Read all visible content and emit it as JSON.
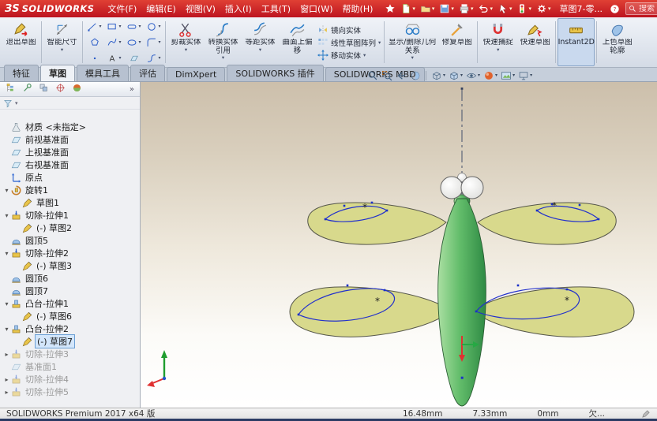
{
  "titlebar": {
    "logo_mark": "ЗS",
    "logo_text": "SOLIDWORKS",
    "menus": [
      "文件(F)",
      "编辑(E)",
      "视图(V)",
      "插入(I)",
      "工具(T)",
      "窗口(W)",
      "帮助(H)"
    ],
    "tools": [
      {
        "name": "pin-toolbar-button",
        "icon": "star",
        "caret": false
      },
      {
        "name": "new-document-button",
        "icon": "new-doc",
        "caret": true
      },
      {
        "name": "open-document-button",
        "icon": "open",
        "caret": true
      },
      {
        "name": "save-button",
        "icon": "save",
        "caret": true
      },
      {
        "name": "print-button",
        "icon": "print",
        "caret": true
      },
      {
        "name": "undo-button",
        "icon": "undo",
        "caret": true
      },
      {
        "name": "select-button",
        "icon": "cursor",
        "caret": true
      },
      {
        "name": "rebuild-button",
        "icon": "rebuild",
        "caret": true
      },
      {
        "name": "options-button",
        "icon": "gear",
        "caret": true
      }
    ],
    "doc_title": "草图7-零...",
    "search_placeholder": "搜索 SOLID...",
    "search_caret": "▾"
  },
  "ribbon": {
    "items": [
      {
        "kind": "big",
        "name": "exit-sketch-button",
        "icon": "exit-sketch",
        "label": "退出草图"
      },
      {
        "kind": "sep"
      },
      {
        "kind": "big",
        "name": "smart-dimension-button",
        "icon": "smart-dimension",
        "label": "智能尺寸",
        "caret": true
      },
      {
        "kind": "sep"
      },
      {
        "kind": "grid",
        "name": "sketch-entities-grid",
        "cells": [
          {
            "name": "line-tool-button",
            "icon": "line-tool",
            "caret": true
          },
          {
            "name": "rectangle-tool-button",
            "icon": "rect-tool",
            "caret": true
          },
          {
            "name": "slot-tool-button",
            "icon": "slot-tool",
            "caret": true
          },
          {
            "name": "circle-tool-button",
            "icon": "circle-tool",
            "caret": true
          },
          {
            "name": "polygon-tool-button",
            "icon": "polygon-tool",
            "caret": false
          },
          {
            "name": "spline-tool-button",
            "icon": "spline-tool",
            "caret": true
          },
          {
            "name": "ellipse-tool-button",
            "icon": "ellipse-tool",
            "caret": true
          },
          {
            "name": "sketch-fillet-button",
            "icon": "fillet-tool",
            "caret": true
          },
          {
            "name": "point-tool-button",
            "icon": "point-tool",
            "caret": false
          },
          {
            "name": "text-tool-button",
            "icon": "text-tool",
            "caret": true
          },
          {
            "name": "plane-tool-button",
            "icon": "plane-tool",
            "caret": false
          },
          {
            "name": "equation-curve-button",
            "icon": "curve-tool",
            "caret": true
          }
        ]
      },
      {
        "kind": "sep"
      },
      {
        "kind": "big",
        "name": "trim-entities-button",
        "icon": "trim",
        "label": "剪裁实体",
        "caret": true
      },
      {
        "kind": "big",
        "name": "convert-entities-button",
        "icon": "convert",
        "label": "转换实体引用",
        "caret": true
      },
      {
        "kind": "big",
        "name": "offset-entities-button",
        "icon": "offset",
        "label": "等距实体",
        "caret": true
      },
      {
        "kind": "big",
        "name": "offset-on-surface-button",
        "icon": "offset-surface",
        "label": "曲面上偏移"
      },
      {
        "kind": "stack",
        "name": "transform-stack",
        "rows": [
          {
            "name": "mirror-entities-button",
            "icon": "mirror",
            "label": "镜向实体",
            "caret": false
          },
          {
            "name": "linear-sketch-pattern-button",
            "icon": "pattern",
            "label": "线性草图阵列",
            "caret": true
          },
          {
            "name": "move-entities-button",
            "icon": "move",
            "label": "移动实体",
            "caret": true
          }
        ]
      },
      {
        "kind": "sep"
      },
      {
        "kind": "big",
        "name": "display-delete-relations-button",
        "icon": "relations",
        "label": "显示/删除几何关系",
        "caret": true,
        "wide": true
      },
      {
        "kind": "big",
        "name": "repair-sketch-button",
        "icon": "repair",
        "label": "修复草图"
      },
      {
        "kind": "sep"
      },
      {
        "kind": "big",
        "name": "quick-snaps-button",
        "icon": "snaps",
        "label": "快速捕捉",
        "caret": true
      },
      {
        "kind": "big",
        "name": "rapid-sketch-button",
        "icon": "rapid",
        "label": "快速草图"
      },
      {
        "kind": "sep"
      },
      {
        "kind": "big",
        "name": "instant2d-button",
        "icon": "instant2d",
        "label": "Instant2D",
        "active": true
      },
      {
        "kind": "sep"
      },
      {
        "kind": "big",
        "name": "shaded-sketch-contours-button",
        "icon": "shaded-contours",
        "label": "上色草图轮廓"
      }
    ]
  },
  "tabs": [
    {
      "name": "tab-features",
      "label": "特征",
      "active": false
    },
    {
      "name": "tab-sketch",
      "label": "草图",
      "active": true
    },
    {
      "name": "tab-mold-tools",
      "label": "模具工具",
      "active": false
    },
    {
      "name": "tab-evaluate",
      "label": "评估",
      "active": false
    },
    {
      "name": "tab-dimxpert",
      "label": "DimXpert",
      "active": false
    },
    {
      "name": "tab-solidworks-addins",
      "label": "SOLIDWORKS 插件",
      "active": false
    },
    {
      "name": "tab-solidworks-mbd",
      "label": "SOLIDWORKS MBD",
      "active": false
    }
  ],
  "hud": [
    {
      "name": "zoom-fit-button",
      "icon": "magnifier",
      "caret": false
    },
    {
      "name": "zoom-area-button",
      "icon": "zoom-area",
      "caret": false
    },
    {
      "name": "previous-view-button",
      "icon": "prev-view",
      "caret": false
    },
    {
      "name": "section-view-button",
      "icon": "section",
      "caret": false
    },
    {
      "sep": true
    },
    {
      "name": "view-orientation-button",
      "icon": "cube",
      "caret": true
    },
    {
      "name": "display-style-button",
      "icon": "cube-shaded",
      "caret": true
    },
    {
      "name": "hide-show-items-button",
      "icon": "eye",
      "caret": true
    },
    {
      "name": "edit-appearance-button",
      "icon": "ball",
      "caret": true
    },
    {
      "name": "apply-scene-button",
      "icon": "scene",
      "caret": true
    },
    {
      "name": "view-settings-button",
      "icon": "monitor",
      "caret": true
    }
  ],
  "manager": {
    "tabs": [
      {
        "name": "featuremanager-tab",
        "icon": "mgr-tree"
      },
      {
        "name": "propertymanager-tab",
        "icon": "mgr-prop"
      },
      {
        "name": "configurationmanager-tab",
        "icon": "mgr-config"
      },
      {
        "name": "dimxpertmanager-tab",
        "icon": "mgr-dimx"
      },
      {
        "name": "displaymanager-tab",
        "icon": "mgr-display"
      }
    ],
    "expand_chevron": "»"
  },
  "tree": {
    "items": [
      {
        "label": "材质 <未指定>",
        "icon": "material",
        "depth": 0,
        "caret": "none"
      },
      {
        "label": "前视基准面",
        "icon": "plane",
        "depth": 0,
        "caret": "none"
      },
      {
        "label": "上视基准面",
        "icon": "plane",
        "depth": 0,
        "caret": "none"
      },
      {
        "label": "右视基准面",
        "icon": "plane",
        "depth": 0,
        "caret": "none"
      },
      {
        "label": "原点",
        "icon": "origin",
        "depth": 0,
        "caret": "none"
      },
      {
        "label": "旋转1",
        "icon": "revolve",
        "depth": 0,
        "caret": "down"
      },
      {
        "label": "草图1",
        "icon": "sketch",
        "depth": 1,
        "caret": "none"
      },
      {
        "label": "切除-拉伸1",
        "icon": "cut",
        "depth": 0,
        "caret": "down"
      },
      {
        "label": "(-) 草图2",
        "icon": "sketch",
        "depth": 1,
        "caret": "none"
      },
      {
        "label": "圆顶5",
        "icon": "dome",
        "depth": 0,
        "caret": "none"
      },
      {
        "label": "切除-拉伸2",
        "icon": "cut",
        "depth": 0,
        "caret": "down"
      },
      {
        "label": "(-) 草图3",
        "icon": "sketch",
        "depth": 1,
        "caret": "none"
      },
      {
        "label": "圆顶6",
        "icon": "dome",
        "depth": 0,
        "caret": "none"
      },
      {
        "label": "圆顶7",
        "icon": "dome",
        "depth": 0,
        "caret": "none"
      },
      {
        "label": "凸台-拉伸1",
        "icon": "boss",
        "depth": 0,
        "caret": "down"
      },
      {
        "label": "(-) 草图6",
        "icon": "sketch",
        "depth": 1,
        "caret": "none"
      },
      {
        "label": "凸台-拉伸2",
        "icon": "boss",
        "depth": 0,
        "caret": "down"
      },
      {
        "label": "(-) 草图7",
        "icon": "sketch",
        "depth": 1,
        "caret": "none",
        "selected": true
      },
      {
        "label": "切除-拉伸3",
        "icon": "cut",
        "depth": 0,
        "caret": "right",
        "dimmed": true
      },
      {
        "label": "基准面1",
        "icon": "plane",
        "depth": 0,
        "caret": "none",
        "dimmed": true
      },
      {
        "label": "切除-拉伸4",
        "icon": "cut",
        "depth": 0,
        "caret": "right",
        "dimmed": true
      },
      {
        "label": "切除-拉伸5",
        "icon": "cut",
        "depth": 0,
        "caret": "right",
        "dimmed": true
      }
    ]
  },
  "viewport": {
    "sketch_point_glyph": "*"
  },
  "statusbar": {
    "left": "SOLIDWORKS Premium 2017 x64 版",
    "values": [
      {
        "name": "measure-x",
        "text": "16.48mm"
      },
      {
        "name": "measure-y",
        "text": "7.33mm"
      },
      {
        "name": "measure-z",
        "text": "0mm"
      },
      {
        "name": "definition-status",
        "text": "欠..."
      }
    ]
  }
}
